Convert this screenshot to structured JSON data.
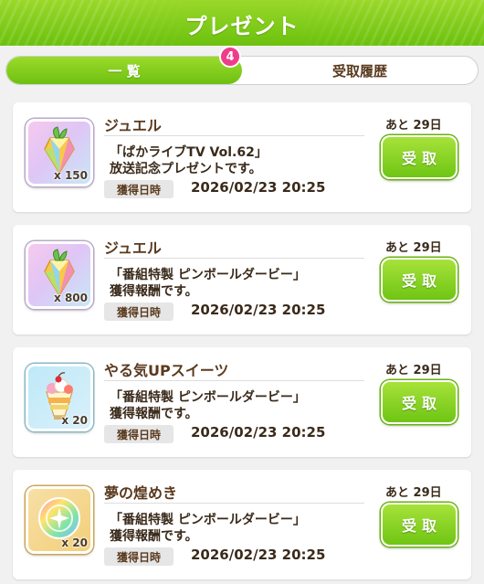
{
  "header": {
    "title": "プレゼント"
  },
  "tabs": [
    {
      "label": "一 覧",
      "active": true
    },
    {
      "label": "受取履歴",
      "active": false
    }
  ],
  "badge_count": "4",
  "obtain_label": "獲得日時",
  "receive_label": "受取",
  "items": [
    {
      "name": "ジュエル",
      "icon": "jewel-icon",
      "quantity": "x 150",
      "description": "「ぱかライブTV Vol.62」\n放送記念プレゼントです。",
      "obtained_at": "2026/02/23 20:25",
      "remaining": "あと 29日"
    },
    {
      "name": "ジュエル",
      "icon": "jewel-icon",
      "quantity": "x 800",
      "description": "「番組特製 ピンボールダービー」\n獲得報酬です。",
      "obtained_at": "2026/02/23 20:25",
      "remaining": "あと 29日"
    },
    {
      "name": "やる気UPスイーツ",
      "icon": "parfait-icon",
      "quantity": "x 20",
      "description": "「番組特製 ピンボールダービー」\n獲得報酬です。",
      "obtained_at": "2026/02/23 20:25",
      "remaining": "あと 29日"
    },
    {
      "name": "夢の煌めき",
      "icon": "dream-sparkle-icon",
      "quantity": "x 20",
      "description": "「番組特製 ピンボールダービー」\n獲得報酬です。",
      "obtained_at": "2026/02/23 20:25",
      "remaining": "あと 29日"
    }
  ],
  "colors": {
    "accent_green": "#7cc81a",
    "badge_pink": "#ee3d8a",
    "text_brown": "#5a3a1e"
  }
}
